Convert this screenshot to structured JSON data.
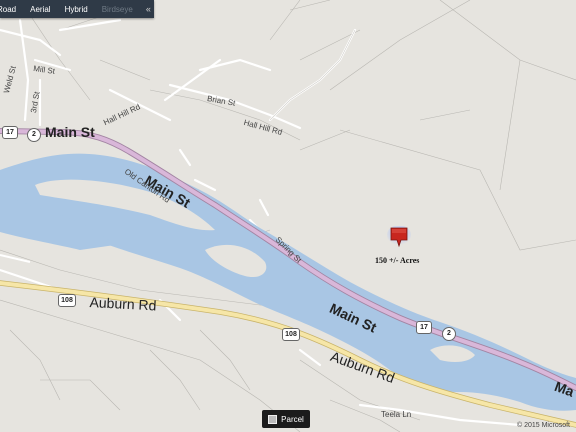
{
  "toolbar": {
    "items": [
      "Road",
      "Aerial",
      "Hybrid",
      "Birdseye"
    ],
    "collapse_icon": "«"
  },
  "labels": {
    "main_st_1": "Main St",
    "main_st_2": "Main St",
    "main_st_3": "Main St",
    "main_st_4": "Ma",
    "auburn_1": "Auburn Rd",
    "auburn_2": "Auburn Rd",
    "mill_st": "Mill St",
    "weld_st": "Weld St",
    "third_st": "3rd St",
    "brian_st": "Brian St",
    "hall_hill_1": "Hall Hill Rd",
    "hall_hill_2": "Hall Hill Rd",
    "old_canton": "Old Canton Rd",
    "spring_st": "Spring St",
    "teela_ln": "Teela Ln"
  },
  "shields": {
    "r17_a": "17",
    "r2_a": "2",
    "r17_b": "17",
    "r2_b": "2",
    "r108_a": "108",
    "r108_b": "108"
  },
  "marker": {
    "label": "150 +/- Acres",
    "icon": "map-pin-icon",
    "color": "#c8261f"
  },
  "parcel_button": {
    "label": "Parcel"
  },
  "copyright": "© 2015 Microsoft",
  "colors": {
    "land": "#e6e4df",
    "water": "#a9c6e4",
    "main_road": "#c9a6c9",
    "secondary_road": "#f6e6a7"
  }
}
